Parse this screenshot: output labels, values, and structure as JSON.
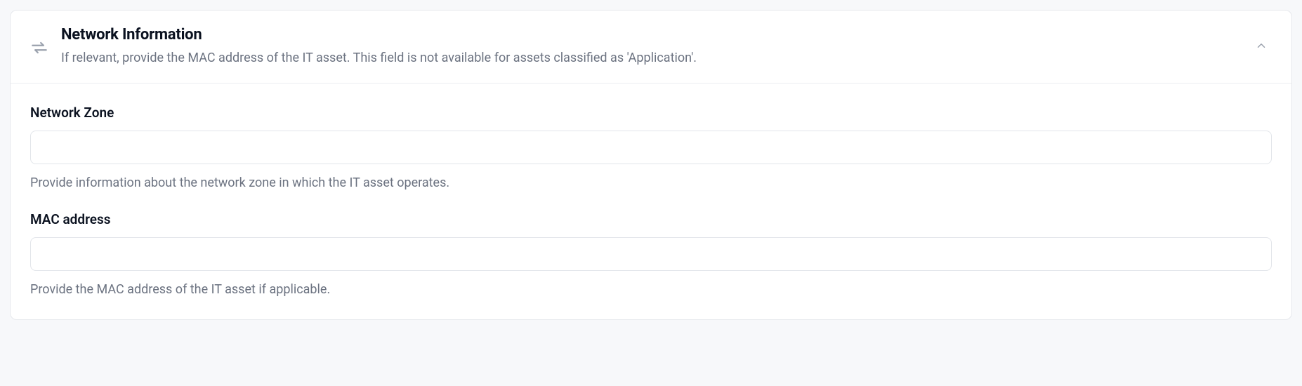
{
  "section": {
    "title": "Network Information",
    "description": "If relevant, provide the MAC address of the IT asset. This field is not available for assets classified as 'Application'."
  },
  "fields": {
    "network_zone": {
      "label": "Network Zone",
      "value": "",
      "help": "Provide information about the network zone in which the IT asset operates."
    },
    "mac_address": {
      "label": "MAC address",
      "value": "",
      "help": "Provide the MAC address of the IT asset if applicable."
    }
  }
}
